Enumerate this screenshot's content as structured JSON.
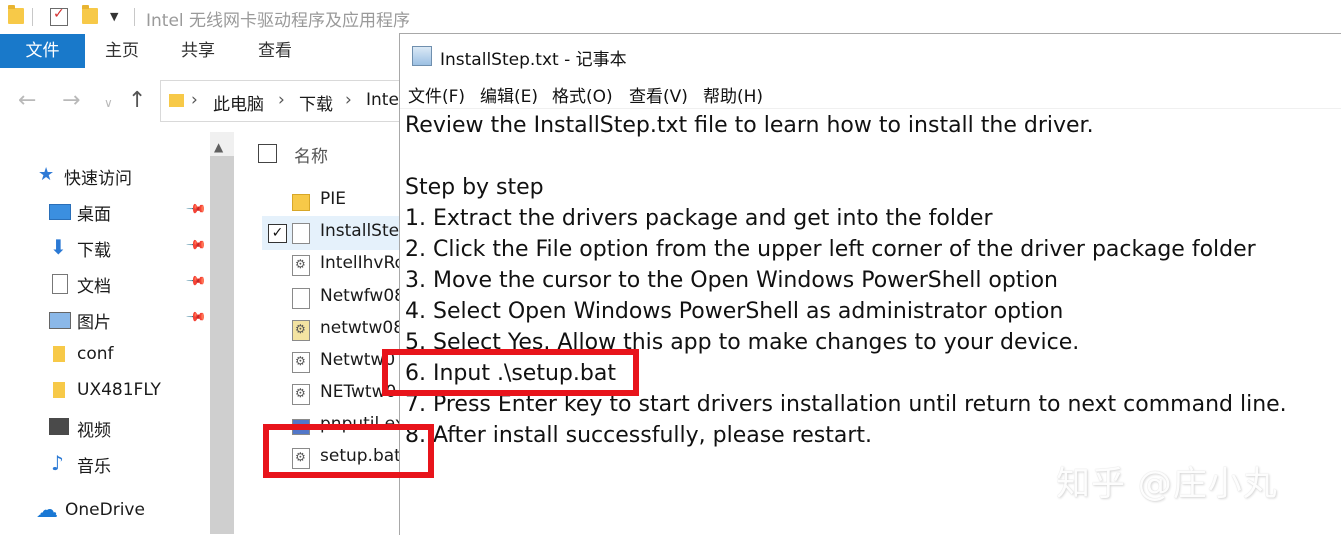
{
  "explorer": {
    "title": "Intel 无线网卡驱动程序及应用程序",
    "ribbon_tabs": [
      "文件",
      "主页",
      "共享",
      "查看"
    ],
    "breadcrumb": [
      "此电脑",
      "下载",
      "Inte"
    ],
    "nav_items": [
      {
        "label": "快速访问",
        "icon": "star-icon"
      },
      {
        "label": "桌面",
        "icon": "desktop-icon",
        "pinned": true
      },
      {
        "label": "下载",
        "icon": "download-icon",
        "pinned": true
      },
      {
        "label": "文档",
        "icon": "document-icon",
        "pinned": true
      },
      {
        "label": "图片",
        "icon": "pictures-icon",
        "pinned": true
      },
      {
        "label": "conf",
        "icon": "folder-icon"
      },
      {
        "label": "UX481FLY",
        "icon": "folder-icon"
      },
      {
        "label": "视频",
        "icon": "video-icon"
      },
      {
        "label": "音乐",
        "icon": "music-icon"
      },
      {
        "label": "OneDrive",
        "icon": "cloud-icon"
      }
    ],
    "column_header": "名称",
    "files": [
      {
        "name": "PIE",
        "icon": "folder-icon"
      },
      {
        "name": "InstallSte",
        "icon": "text-file-icon",
        "checked": true
      },
      {
        "name": "IntelIhvRo",
        "icon": "settings-file-icon"
      },
      {
        "name": "Netwfw08",
        "icon": "file-icon"
      },
      {
        "name": "netwtw08",
        "icon": "setup-info-icon"
      },
      {
        "name": "Netwtw0",
        "icon": "settings-file-icon"
      },
      {
        "name": "NETwtw0",
        "icon": "settings-file-icon"
      },
      {
        "name": "pnputil.ex",
        "icon": "exe-icon"
      },
      {
        "name": "setup.bat",
        "icon": "batch-file-icon"
      }
    ]
  },
  "notepad": {
    "title": "InstallStep.txt - 记事本",
    "menu": [
      "文件(F)",
      "编辑(E)",
      "格式(O)",
      "查看(V)",
      "帮助(H)"
    ],
    "lines": [
      "Review the InstallStep.txt file to learn how to install the driver.",
      "",
      "Step by step",
      "1. Extract the drivers package and get into the folder",
      "2. Click the File option from the upper left corner of the driver package folder",
      "3. Move the cursor to the Open Windows PowerShell option",
      "4. Select Open Windows PowerShell as administrator option",
      "5. Select Yes. Allow this app to make changes to your device.",
      "6. Input .\\setup.bat",
      "7. Press Enter key to start drivers installation until return to next command line.",
      "8. After install successfully, please restart."
    ]
  },
  "watermark": "知乎 @庄小丸",
  "colors": {
    "accent": "#1979ca",
    "highlight": "#e8141b",
    "selection": "#e5f1fb"
  }
}
